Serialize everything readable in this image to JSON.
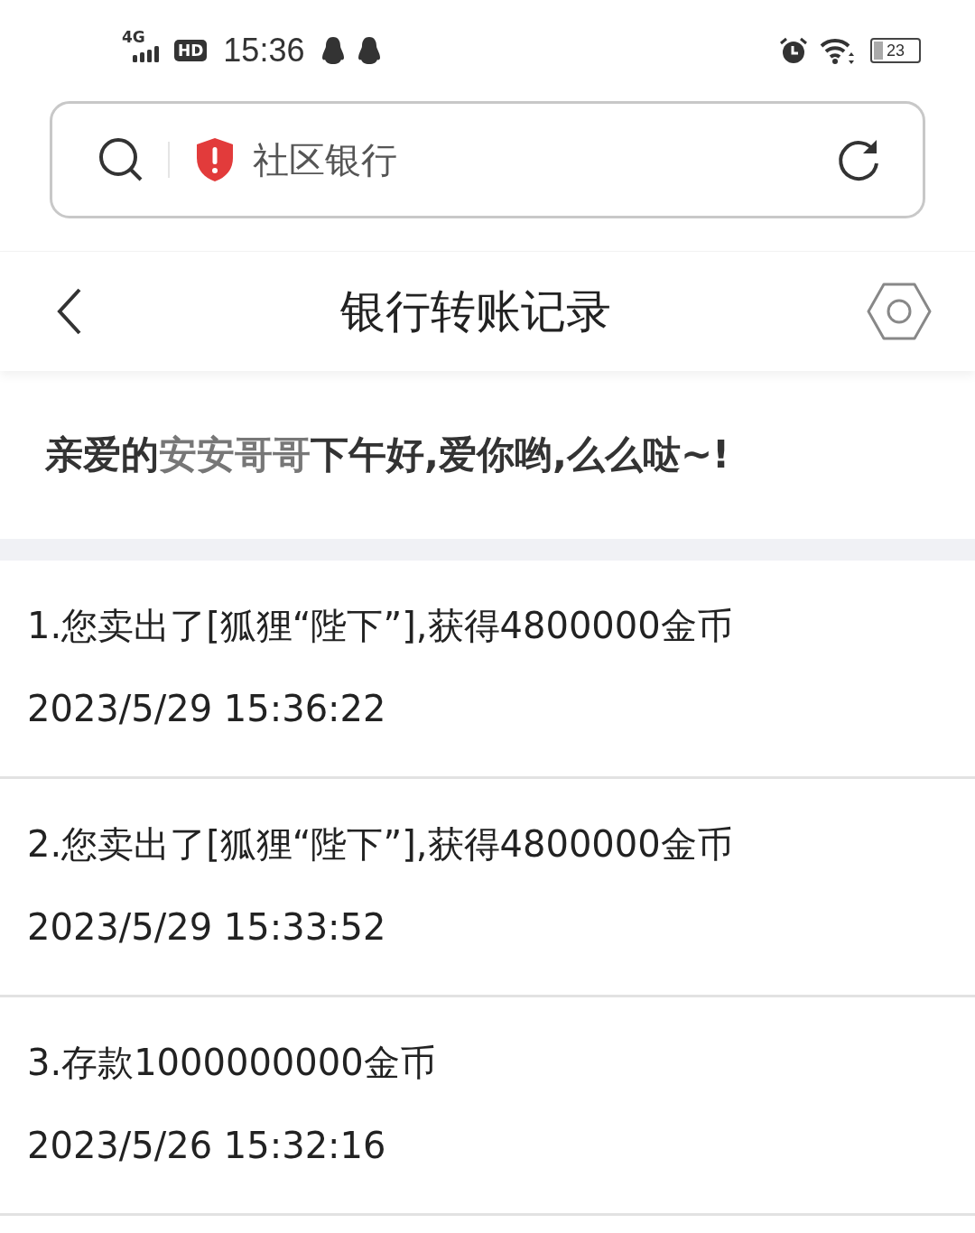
{
  "status_bar": {
    "network": "4G",
    "hd": "HD",
    "time": "15:36",
    "battery": "23"
  },
  "address_bar": {
    "site_name": "社区银行",
    "warning": true
  },
  "header": {
    "title": "银行转账记录"
  },
  "greeting": [
    {
      "text": "亲爱的",
      "highlight": false
    },
    {
      "text": "安安哥哥",
      "highlight": true
    },
    {
      "text": "下午好,爱你哟,么么哒~!",
      "highlight": false
    }
  ],
  "records": [
    {
      "text": "1.您卖出了[狐狸“陛下”],获得4800000金币",
      "time": "2023/5/29 15:36:22"
    },
    {
      "text": "2.您卖出了[狐狸“陛下”],获得4800000金币",
      "time": "2023/5/29 15:33:52"
    },
    {
      "text": "3.存款1000000000金币",
      "time": "2023/5/26 15:32:16"
    }
  ]
}
